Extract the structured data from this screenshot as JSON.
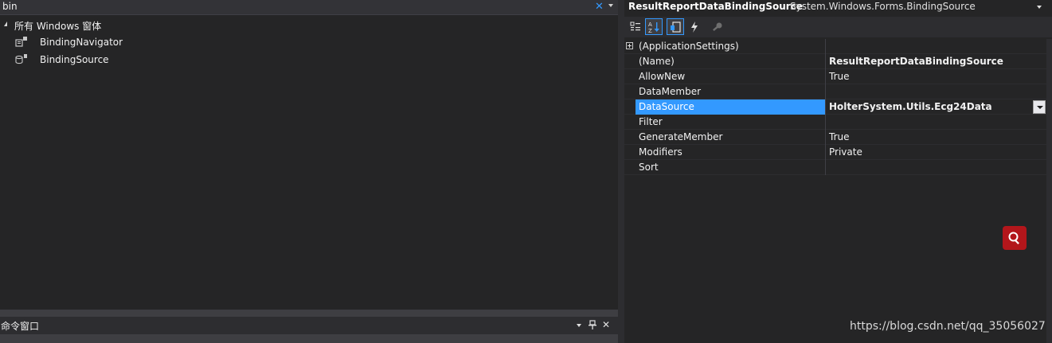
{
  "toolbox": {
    "search_value": "bin",
    "clear_glyph": "✕",
    "group_label": "所有 Windows 窗体",
    "items": [
      {
        "label": "BindingNavigator",
        "icon": "binding-navigator-icon"
      },
      {
        "label": "BindingSource",
        "icon": "binding-source-icon"
      }
    ]
  },
  "command_window": {
    "title": "命令窗口",
    "pin_glyph": "✚",
    "close_glyph": "✕"
  },
  "properties": {
    "object_name": "ResultReportDataBindingSource",
    "object_type": "System.Windows.Forms.BindingSource",
    "rows": [
      {
        "name": "(ApplicationSettings)",
        "value": "",
        "expandable": true
      },
      {
        "name": "(Name)",
        "value": "ResultReportDataBindingSource",
        "bold": true
      },
      {
        "name": "AllowNew",
        "value": "True"
      },
      {
        "name": "DataMember",
        "value": ""
      },
      {
        "name": "DataSource",
        "value": "HolterSystem.Utils.Ecg24Data",
        "bold": true,
        "selected": true,
        "dropdown": true
      },
      {
        "name": "Filter",
        "value": ""
      },
      {
        "name": "GenerateMember",
        "value": "True"
      },
      {
        "name": "Modifiers",
        "value": "Private"
      },
      {
        "name": "Sort",
        "value": ""
      }
    ]
  },
  "colors": {
    "accent": "#3399ff",
    "background": "#252526",
    "fab": "#b3161b"
  },
  "watermark": "https://blog.csdn.net/qq_35056027"
}
